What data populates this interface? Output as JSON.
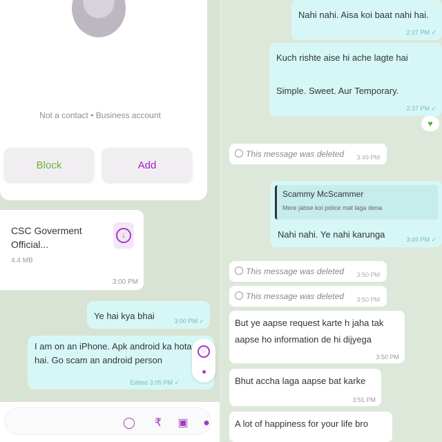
{
  "contact": {
    "note": "Not a contact • Business account",
    "block_label": "Block",
    "add_label": "Add"
  },
  "document": {
    "name": "CSC Goverment Official...",
    "size": "4.4 MB",
    "time": "3:00 PM"
  },
  "left_messages": [
    {
      "text": "Ye hai kya bhai",
      "time": "3:00 PM ✓"
    },
    {
      "text": "I am on an iPhone. Apk android ka hota hai. Go scam an android person",
      "time": "Edited 3:05 PM ✓"
    }
  ],
  "input_icons": [
    "sticker-icon",
    "rupee-icon",
    "camera-icon",
    "mic-icon"
  ],
  "right_messages": {
    "msg1": {
      "text": "Nahi nahi. Aisa koi baat nahi hai.",
      "time": "2:37 PM ✓"
    },
    "msg2": {
      "line1": "Kuch rishte aise hi ache lagte hai",
      "line2": "Simple. Sweet. Aur Temporary.",
      "time": "2:37 PM ✓"
    },
    "reaction": "♥",
    "deleted_label": "This message was deleted",
    "deleted": [
      {
        "time": "3:49 PM"
      },
      {
        "time": "3:50 PM"
      },
      {
        "time": "3:50 PM"
      }
    ],
    "reply": {
      "quoted_name": "Scammy McScammer",
      "quoted_text": "Mere jabse koi police mat laga dena",
      "text": "Nahi nahi. Ye nahi karunga",
      "time": "3:49 PM ✓"
    },
    "incoming": [
      {
        "text": "But ye aapse request karte h jaha tak aapse ho information de hi dijyega",
        "time": "3:50 PM"
      },
      {
        "text": "Bhut accha laga aapse bat karke",
        "time": "3:51 PM"
      },
      {
        "text": "A lot of happiness for your life bro",
        "time": ""
      }
    ]
  }
}
